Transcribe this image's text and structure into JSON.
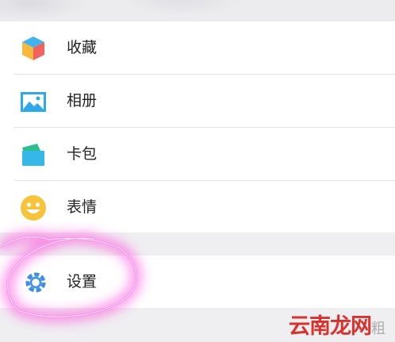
{
  "menu": {
    "items": [
      {
        "label": "收藏",
        "icon": "cube-icon"
      },
      {
        "label": "相册",
        "icon": "picture-icon"
      },
      {
        "label": "卡包",
        "icon": "card-wallet-icon"
      },
      {
        "label": "表情",
        "icon": "smiley-icon"
      }
    ],
    "settings": {
      "label": "设置",
      "icon": "gear-icon"
    }
  },
  "annotation": {
    "color": "#ff3fd8"
  },
  "watermark": {
    "text": "云南龙网",
    "tail": "粗"
  }
}
